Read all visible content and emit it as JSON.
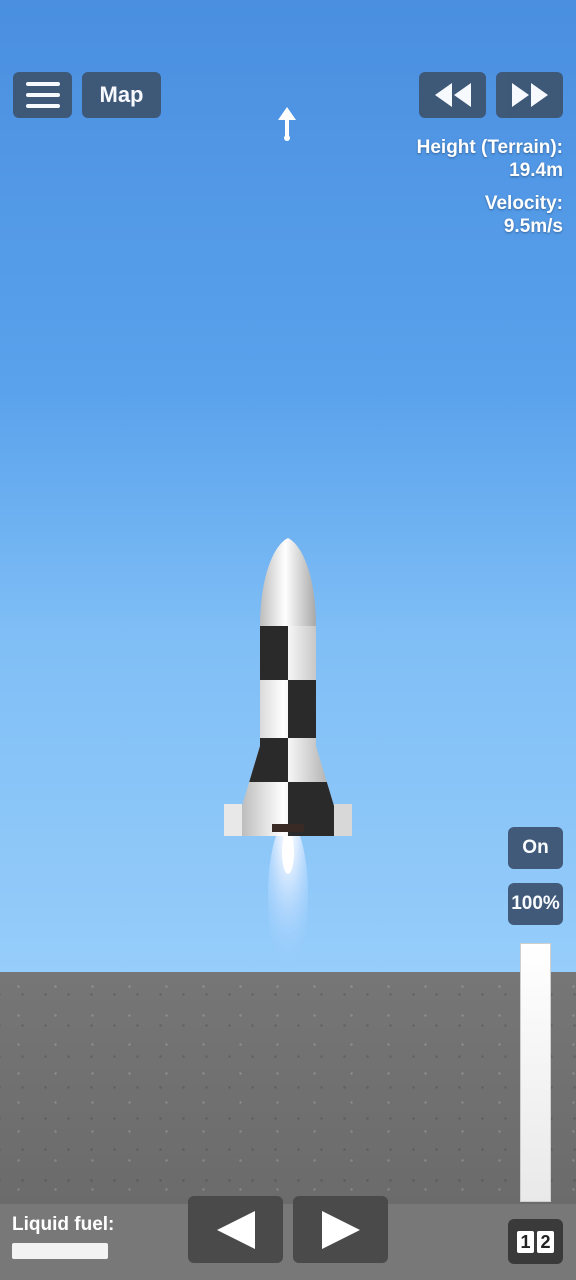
{
  "toolbar": {
    "map_label": "Map",
    "menu_icon": "hamburger-menu-icon",
    "rewind_icon": "rewind-icon",
    "fast_forward_icon": "fast-forward-icon"
  },
  "telemetry": {
    "height_label": "Height (Terrain):",
    "height_value": "19.4m",
    "velocity_label": "Velocity:",
    "velocity_value": "9.5m/s"
  },
  "engine": {
    "toggle_label": "On",
    "throttle_label": "100%",
    "throttle_fraction": 1.0
  },
  "fuel": {
    "label": "Liquid fuel:",
    "fraction": 1.0
  },
  "stages": [
    "1",
    "2"
  ],
  "colors": {
    "button_bg": "#3e5573",
    "sky_top": "#4a8fe0",
    "sky_bottom": "#96cdfa",
    "ground": "#707070"
  }
}
